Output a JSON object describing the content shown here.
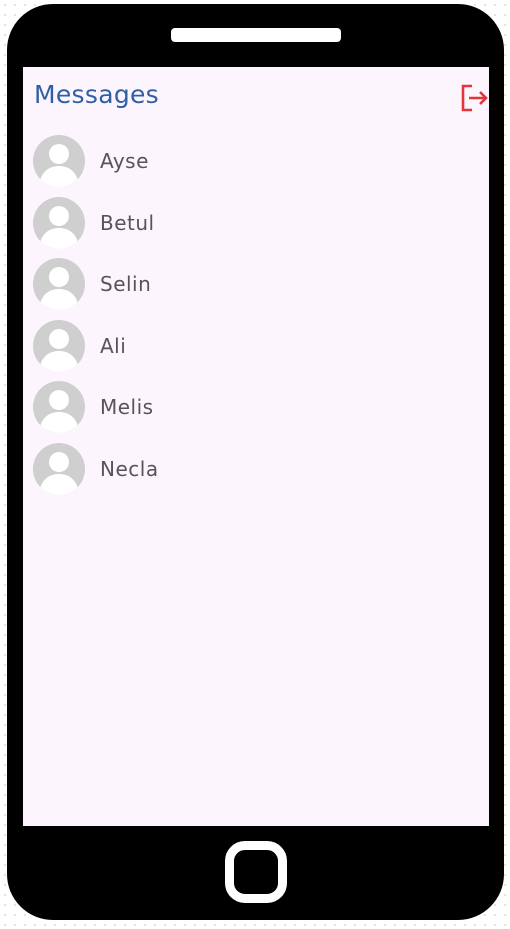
{
  "header": {
    "title": "Messages",
    "logout_icon": "logout-icon"
  },
  "contacts": [
    {
      "name": "Ayse",
      "avatar": "user-avatar-icon"
    },
    {
      "name": "Betul",
      "avatar": "user-avatar-icon"
    },
    {
      "name": "Selin",
      "avatar": "user-avatar-icon"
    },
    {
      "name": "Ali",
      "avatar": "user-avatar-icon"
    },
    {
      "name": "Melis",
      "avatar": "user-avatar-icon"
    },
    {
      "name": "Necla",
      "avatar": "user-avatar-icon"
    }
  ],
  "colors": {
    "title": "#2f5fa4",
    "logout": "#e5343a",
    "screen_bg": "#fcf5fe",
    "avatar_bg": "#cfcfcf",
    "name_text": "#555555"
  }
}
